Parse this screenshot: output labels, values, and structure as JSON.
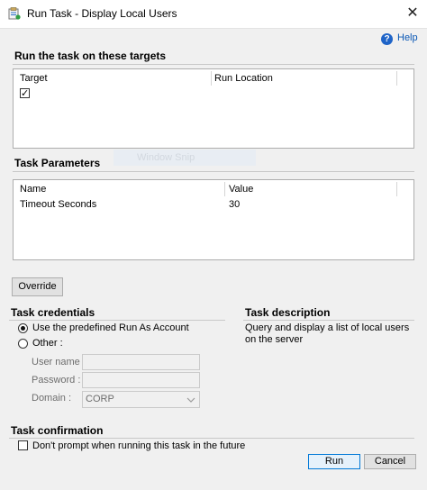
{
  "window": {
    "title": "Run Task - Display Local Users",
    "app_icon": "task-icon",
    "close_glyph": "✕",
    "help_label": "Help"
  },
  "targets": {
    "heading": "Run the task on these targets",
    "columns": [
      "Target",
      "Run Location"
    ],
    "rows": [
      {
        "checked": true,
        "target": "",
        "run_location": ""
      }
    ]
  },
  "parameters": {
    "heading": "Task Parameters",
    "columns": [
      "Name",
      "Value"
    ],
    "rows": [
      {
        "name": "Timeout Seconds",
        "value": "30"
      }
    ],
    "override_label": "Override"
  },
  "overlay": {
    "ghost_text": "Window Snip"
  },
  "credentials": {
    "heading": "Task credentials",
    "option_predefined": "Use the predefined Run As Account",
    "option_other": "Other :",
    "selected": "predefined",
    "username_label": "User name :",
    "username_value": "",
    "password_label": "Password :",
    "password_value": "",
    "domain_label": "Domain :",
    "domain_value": "CORP"
  },
  "description": {
    "heading": "Task description",
    "text": "Query and display a list of local users on the server"
  },
  "confirmation": {
    "heading": "Task confirmation",
    "checkbox_label": "Don't prompt when running this task in the future",
    "checked": false
  },
  "buttons": {
    "run": "Run",
    "cancel": "Cancel"
  }
}
